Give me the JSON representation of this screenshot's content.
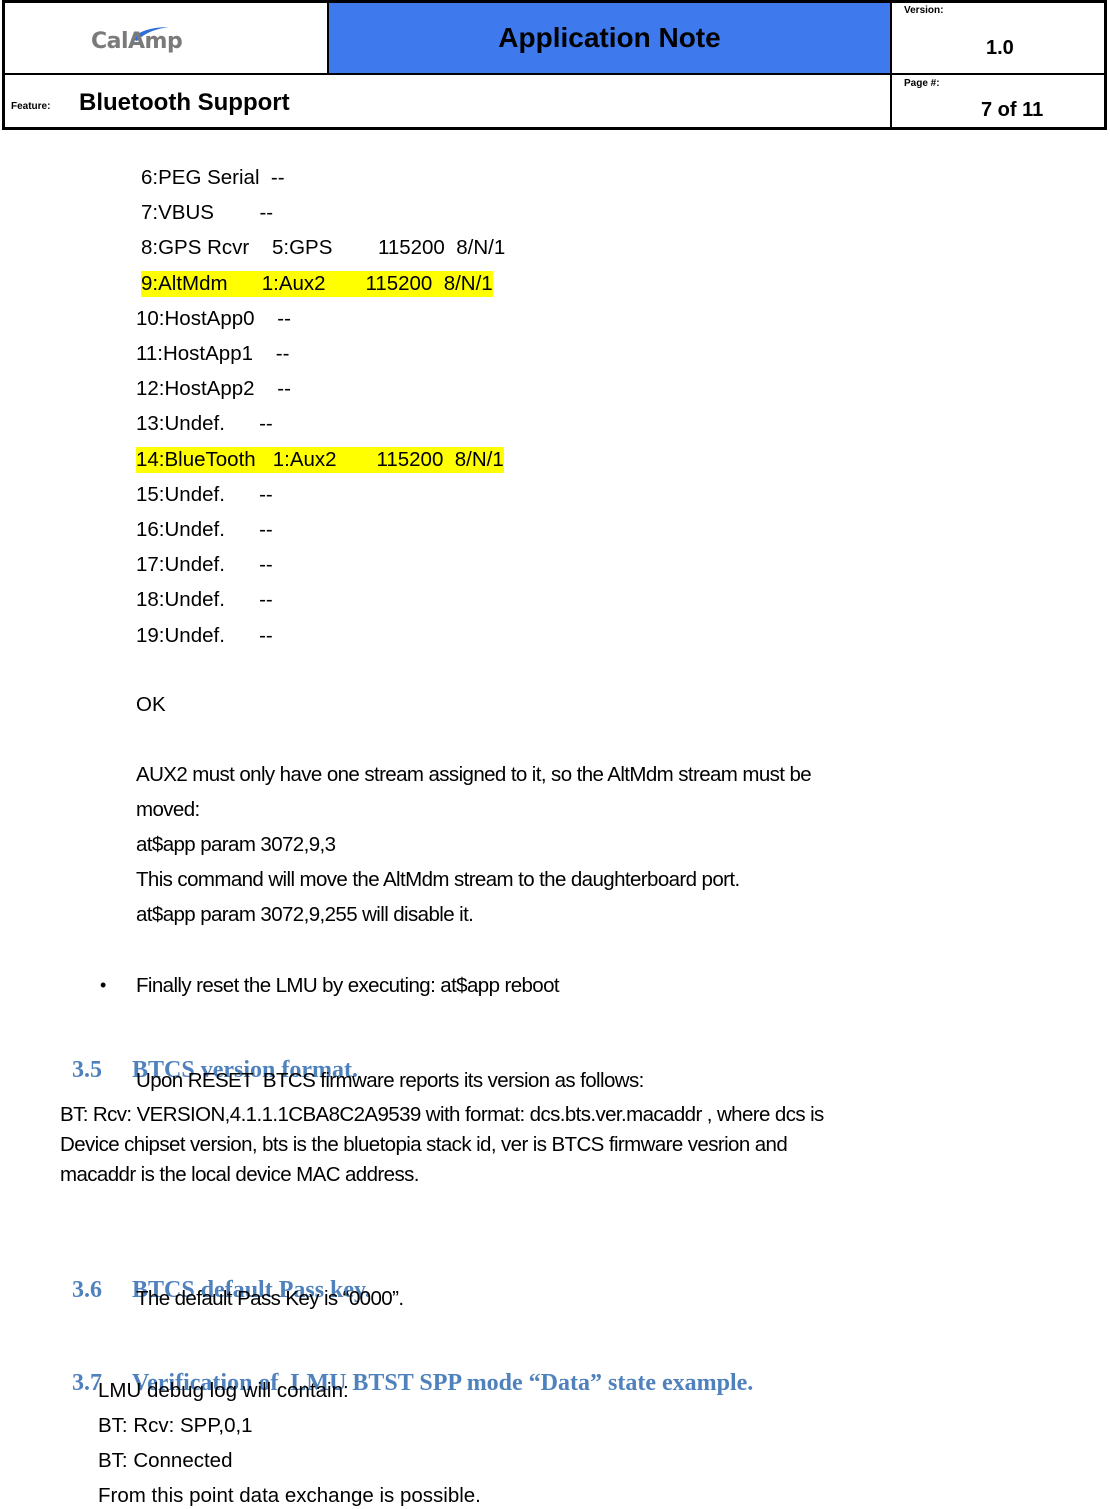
{
  "header": {
    "logo_text": "CalAmp",
    "title": "Application Note",
    "version_label": "Version:",
    "version_value": "1.0",
    "feature_label": "Feature:",
    "feature_value": "Bluetooth Support",
    "page_label": "Page #:",
    "page_value": "7 of 11"
  },
  "stream_list": [
    {
      "text": "6:PEG Serial  --",
      "highlight": false
    },
    {
      "text": "7:VBUS        --",
      "highlight": false
    },
    {
      "text": "8:GPS Rcvr    5:GPS        115200  8/N/1",
      "highlight": false
    },
    {
      "text": "9:AltMdm      1:Aux2       115200  8/N/1",
      "highlight": true
    },
    {
      "text": "10:HostApp0    --",
      "highlight": false
    },
    {
      "text": "11:HostApp1    --",
      "highlight": false
    },
    {
      "text": "12:HostApp2    --",
      "highlight": false
    },
    {
      "text": "13:Undef.      --",
      "highlight": false
    },
    {
      "text": "14:BlueTooth   1:Aux2       115200  8/N/1",
      "highlight": true
    },
    {
      "text": "15:Undef.      --",
      "highlight": false
    },
    {
      "text": "16:Undef.      --",
      "highlight": false
    },
    {
      "text": "17:Undef.      --",
      "highlight": false
    },
    {
      "text": "18:Undef.      --",
      "highlight": false
    },
    {
      "text": "19:Undef.      --",
      "highlight": false
    }
  ],
  "ok_text": "OK",
  "aux2_note": {
    "line1": "AUX2 must only have one stream assigned to it, so the AltMdm stream must be",
    "line2": "moved:",
    "line3": "at$app param 3072,9,3",
    "line4": "This command will move the AltMdm stream to the daughterboard port.",
    "line5": "at$app param 3072,9,255 will disable it."
  },
  "bullet": {
    "symbol": "•",
    "text": "Finally reset the LMU by executing: at$app reboot"
  },
  "sections": [
    {
      "number": "3.5",
      "title": "BTCS version format.",
      "lines": [
        "Upon RESET  BTCS firmware reports its version as follows:",
        "BT: Rcv: VERSION,4.1.1.1CBA8C2A9539 with format: dcs.bts.ver.macaddr , where dcs is",
        "Device chipset version, bts is the bluetopia stack id, ver is BTCS firmware vesrion and",
        "macaddr is the local device MAC address."
      ]
    },
    {
      "number": "3.6",
      "title": "BTCS default Pass key.",
      "lines": [
        "The default Pass Key is “0000”."
      ]
    },
    {
      "number": "3.7",
      "title": "Verification of  LMU BTST SPP mode “Data” state example.",
      "lines": [
        "LMU debug log will contain:",
        "BT: Rcv: SPP,0,1",
        "BT: Connected",
        "From this point data exchange is possible."
      ]
    }
  ],
  "colors": {
    "header_blue": "#3e7aee",
    "heading_blue": "#4f81bd",
    "highlight_yellow": "#ffff00"
  }
}
